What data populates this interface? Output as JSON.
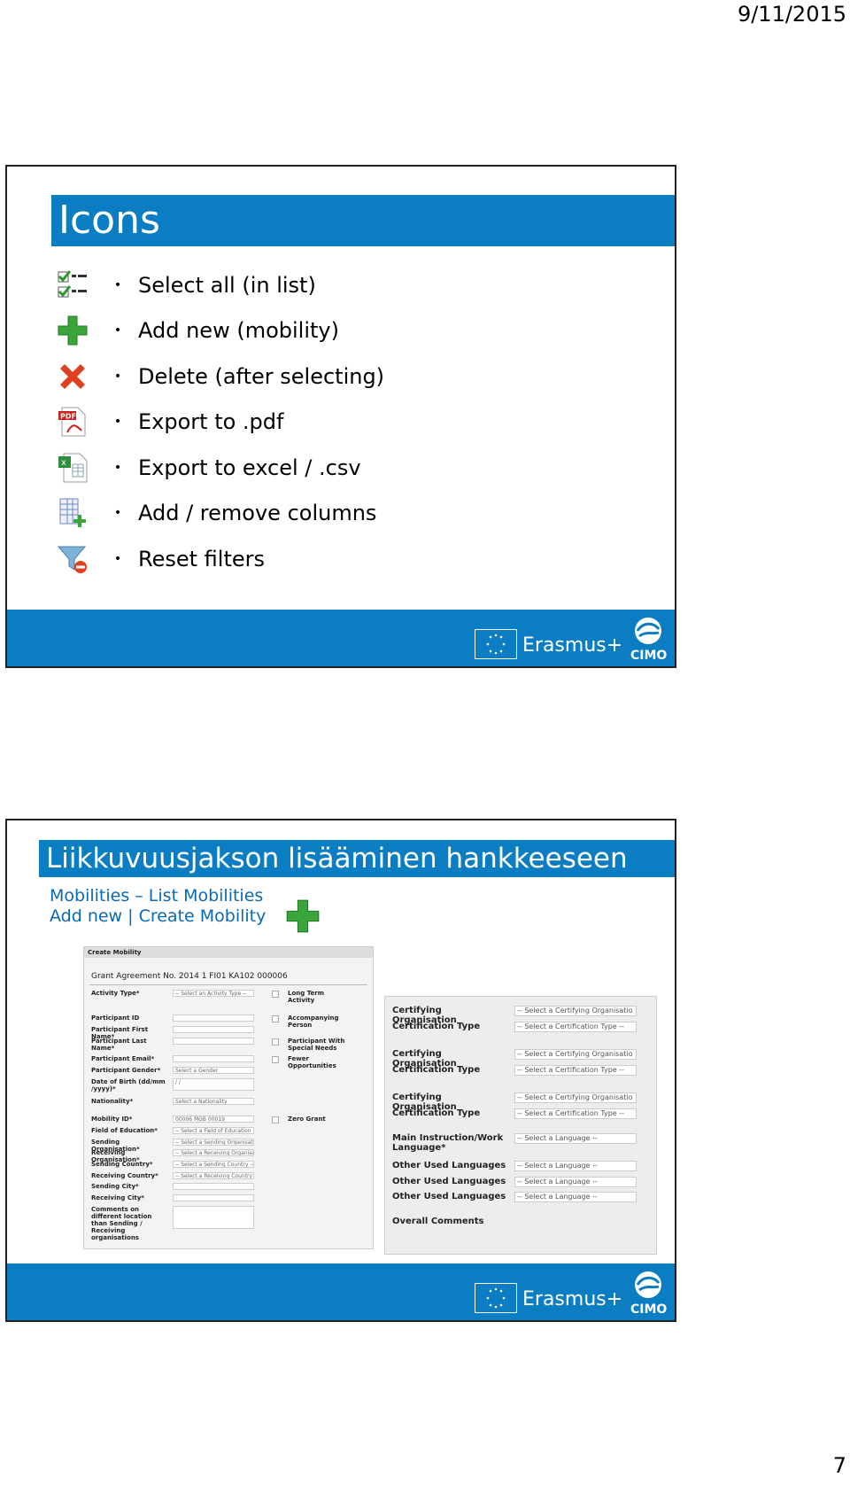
{
  "page": {
    "date": "9/11/2015",
    "page_number": "7"
  },
  "slide1": {
    "title": "Icons",
    "items": [
      {
        "icon": "select-all-icon",
        "label": "Select all (in list)"
      },
      {
        "icon": "add-icon",
        "label": "Add new (mobility)"
      },
      {
        "icon": "delete-icon",
        "label": "Delete (after selecting)"
      },
      {
        "icon": "pdf-icon",
        "label": "Export to .pdf"
      },
      {
        "icon": "excel-icon",
        "label": "Export to excel / .csv"
      },
      {
        "icon": "columns-icon",
        "label": "Add / remove columns"
      },
      {
        "icon": "filter-reset-icon",
        "label": "Reset filters"
      }
    ],
    "footer": {
      "brand": "Erasmus+",
      "logo": "CIMO"
    }
  },
  "slide2": {
    "title": "Liikkuvuusjakson lisääminen hankkeeseen",
    "line1": "Mobilities – List Mobilities",
    "line2": "Add new | Create Mobility",
    "left_form": {
      "header": "Create Mobility",
      "agreement": "Grant Agreement No. 2014 1 FI01 KA102 000006",
      "fields": [
        {
          "label": "Activity Type*",
          "value": "-- Select an Activity Type --"
        },
        {
          "label": "Participant ID",
          "value": ""
        },
        {
          "label": "Participant First Name*",
          "value": ""
        },
        {
          "label": "Participant Last Name*",
          "value": ""
        },
        {
          "label": "Participant Email*",
          "value": ""
        },
        {
          "label": "Participant Gender*",
          "value": "Select a Gender"
        },
        {
          "label": "Date of Birth (dd/mm /yyyy)*",
          "value": "/ /"
        },
        {
          "label": "Nationality*",
          "value": "Select a Nationality"
        },
        {
          "label": "Mobility ID*",
          "value": "00006 MOB 00019"
        },
        {
          "label": "Field of Education*",
          "value": "-- Select a Field of Education --"
        },
        {
          "label": "Sending Organisation*",
          "value": "-- Select a Sending Organisation --"
        },
        {
          "label": "Receiving Organisation*",
          "value": "-- Select a Receiving Organisation --"
        },
        {
          "label": "Sending Country*",
          "value": "-- Select a Sending Country --"
        },
        {
          "label": "Receiving Country*",
          "value": "-- Select a Receiving Country --"
        },
        {
          "label": "Sending City*",
          "value": ""
        },
        {
          "label": "Receiving City*",
          "value": ""
        },
        {
          "label": "Comments on different location than Sending / Receiving organisations",
          "value": ""
        }
      ],
      "checkboxes": [
        "Long Term Activity",
        "Accompanying Person",
        "Participant With Special Needs",
        "Fewer Opportunities",
        "Zero Grant"
      ]
    },
    "right_form": {
      "fields": [
        {
          "label": "Certifying Organisation",
          "value": "-- Select a Certifying Organisatio"
        },
        {
          "label": "Certification Type",
          "value": "-- Select a Certification Type --"
        },
        {
          "label": "Certifying Organisation",
          "value": "-- Select a Certifying Organisatio"
        },
        {
          "label": "Certification Type",
          "value": "-- Select a Certification Type --"
        },
        {
          "label": "Certifying Organisation",
          "value": "-- Select a Certifying Organisatio"
        },
        {
          "label": "Certification Type",
          "value": "-- Select a Certification Type --"
        },
        {
          "label": "Main Instruction/Work Language*",
          "value": "-- Select a Language --"
        },
        {
          "label": "Other Used Languages",
          "value": "-- Select a Language --"
        },
        {
          "label": "Other Used Languages",
          "value": "-- Select a Language --"
        },
        {
          "label": "Other Used Languages",
          "value": "-- Select a Language --"
        },
        {
          "label": "Overall Comments",
          "value": ""
        }
      ]
    },
    "footer": {
      "brand": "Erasmus+",
      "logo": "CIMO"
    }
  }
}
